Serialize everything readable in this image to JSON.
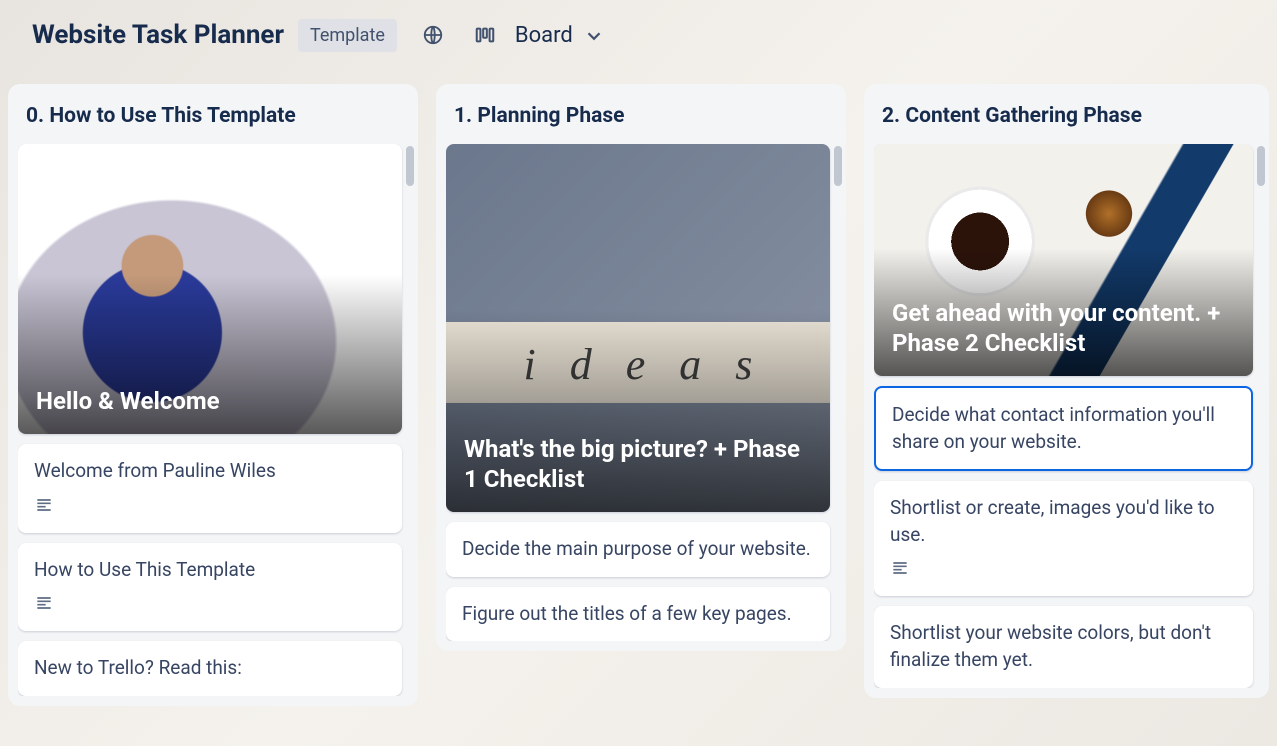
{
  "header": {
    "title": "Website Task Planner",
    "template_pill": "Template",
    "view_label": "Board",
    "globe_icon": "globe-icon",
    "board_switch_icon": "board-columns-icon",
    "chevron_icon": "chevron-down-icon"
  },
  "lists": [
    {
      "title": "0. How to Use This Template",
      "cover_card": {
        "title": "Hello & Welcome",
        "cover_style": "cover-person",
        "cover_variant": "normal"
      },
      "cards": [
        {
          "text": "Welcome from Pauline Wiles",
          "has_description": true,
          "selected": false
        },
        {
          "text": "How to Use This Template",
          "has_description": true,
          "selected": false
        },
        {
          "text": "New to Trello? Read this:",
          "has_description": false,
          "selected": false
        }
      ]
    },
    {
      "title": "1. Planning Phase",
      "cover_card": {
        "title": "What's the big picture? + Phase 1 Checklist",
        "cover_style": "cover-ideas",
        "cover_variant": "tall",
        "ideas_word": "ideas"
      },
      "cards": [
        {
          "text": "Decide the main purpose of your website.",
          "has_description": false,
          "selected": false
        },
        {
          "text": "Figure out the titles of a few key pages.",
          "has_description": false,
          "selected": false
        }
      ]
    },
    {
      "title": "2. Content Gathering Phase",
      "cover_card": {
        "title": "Get ahead with your content. + Phase 2 Checklist",
        "cover_style": "cover-coffee",
        "cover_variant": "short"
      },
      "cards": [
        {
          "text": "Decide what contact information you'll share on your website.",
          "has_description": false,
          "selected": true
        },
        {
          "text": "Shortlist or create, images you'd like to use.",
          "has_description": true,
          "selected": false
        },
        {
          "text": "Shortlist your website colors, but don't finalize them yet.",
          "has_description": false,
          "selected": false
        }
      ]
    }
  ]
}
